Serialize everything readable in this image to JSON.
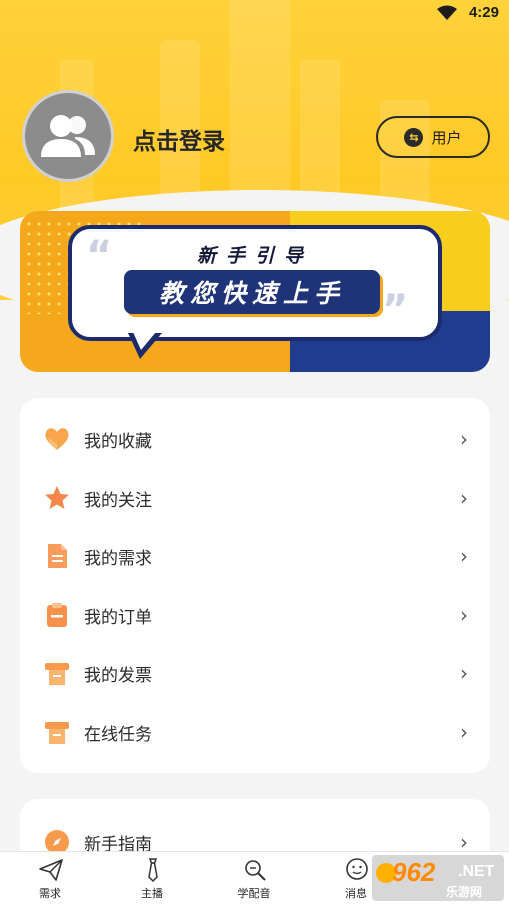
{
  "status_bar": {
    "time": "4:29",
    "wifi_icon": "wifi-icon"
  },
  "profile": {
    "avatar_icon": "users-icon",
    "login_text": "点击登录",
    "role_button_label": "用户",
    "role_button_icon": "switch-icon"
  },
  "banner": {
    "title": "新手引导",
    "subtitle": "教您快速上手",
    "quote_left": "“",
    "quote_right": "”"
  },
  "menu": {
    "items": [
      {
        "label": "我的收藏",
        "icon": "heart-icon",
        "color": "#f6a74a"
      },
      {
        "label": "我的关注",
        "icon": "star-icon",
        "color": "#f58a4a"
      },
      {
        "label": "我的需求",
        "icon": "document-icon",
        "color": "#f79a5a"
      },
      {
        "label": "我的订单",
        "icon": "clipboard-icon",
        "color": "#f7914c"
      },
      {
        "label": "我的发票",
        "icon": "invoice-icon",
        "color": "#f79a4c"
      },
      {
        "label": "在线任务",
        "icon": "task-icon",
        "color": "#f79a4c"
      }
    ]
  },
  "guide": {
    "label": "新手指南",
    "icon": "compass-icon"
  },
  "tabs": [
    {
      "label": "需求",
      "icon": "paper-plane-icon"
    },
    {
      "label": "主播",
      "icon": "tie-icon"
    },
    {
      "label": "学配音",
      "icon": "search-book-icon"
    },
    {
      "label": "消息",
      "icon": "chat-smile-icon"
    }
  ],
  "watermark": {
    "number": "962",
    "suffix": ".NET",
    "site": "乐游网"
  },
  "colors": {
    "accent": "#ffc925",
    "banner_navy": "#1f3c8e",
    "banner_orange": "#f5a81c"
  }
}
